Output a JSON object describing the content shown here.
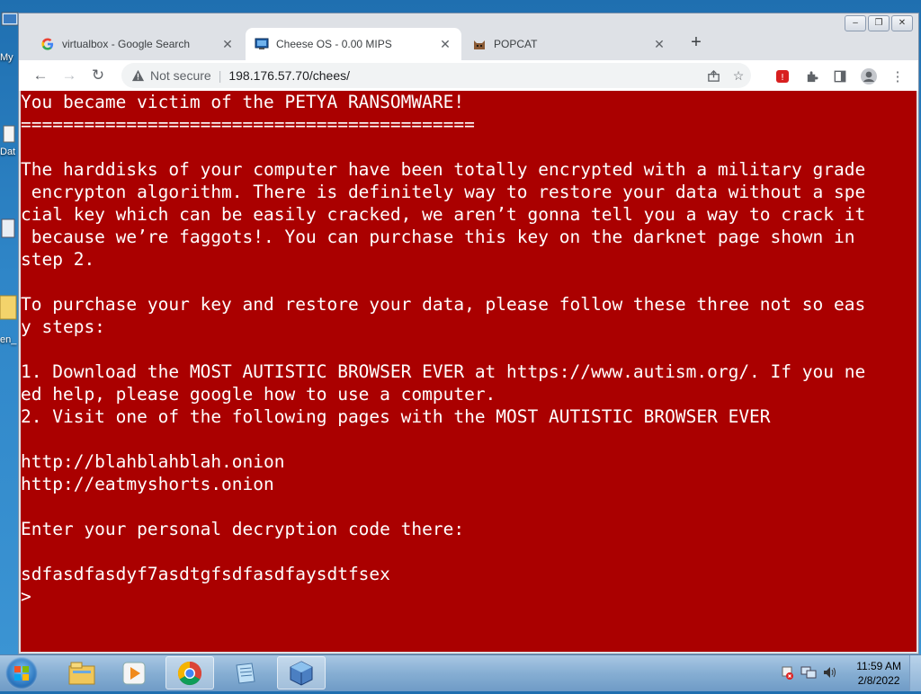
{
  "desktop": {
    "icon_labels": [
      "My",
      "Dat",
      "en_"
    ]
  },
  "browser": {
    "window_controls": [
      "minimize",
      "restore",
      "close"
    ],
    "tabs": [
      {
        "title": "virtualbox - Google Search",
        "favicon": "google-g-icon",
        "active": false
      },
      {
        "title": "Cheese OS - 0.00 MIPS",
        "favicon": "cheeseos-icon",
        "active": true
      },
      {
        "title": "POPCAT",
        "favicon": "popcat-icon",
        "active": false
      }
    ],
    "omnibox": {
      "security_label": "Not secure",
      "url": "198.176.57.70/chees/"
    }
  },
  "terminal": {
    "background": "#aa0000",
    "foreground": "#ffffff",
    "lines": [
      "You became victim of the PETYA RANSOMWARE!",
      "===========================================",
      "",
      "The harddisks of your computer have been totally encrypted with a military grade",
      " encrypton algorithm. There is definitely way to restore your data without a spe",
      "cial key which can be easily cracked, we aren’t gonna tell you a way to crack it",
      " because we’re faggots!. You can purchase this key on the darknet page shown in",
      "step 2.",
      "",
      "To purchase your key and restore your data, please follow these three not so eas",
      "y steps:",
      "",
      "1. Download the MOST AUTISTIC BROWSER EVER at https://www.autism.org/. If you ne",
      "ed help, please google how to use a computer.",
      "2. Visit one of the following pages with the MOST AUTISTIC BROWSER EVER",
      "",
      "http://blahblahblah.onion",
      "http://eatmyshorts.onion",
      "",
      "Enter your personal decryption code there:",
      "",
      "sdfasdfasdyf7asdtgfsdfasdfaysdtfsex",
      ">"
    ]
  },
  "taskbar": {
    "pinned": [
      "windows-explorer-icon",
      "media-player-icon",
      "chrome-icon",
      "notepad-icon",
      "virtualbox-icon"
    ],
    "clock_time": "11:59 AM",
    "clock_date": "2/8/2022"
  }
}
